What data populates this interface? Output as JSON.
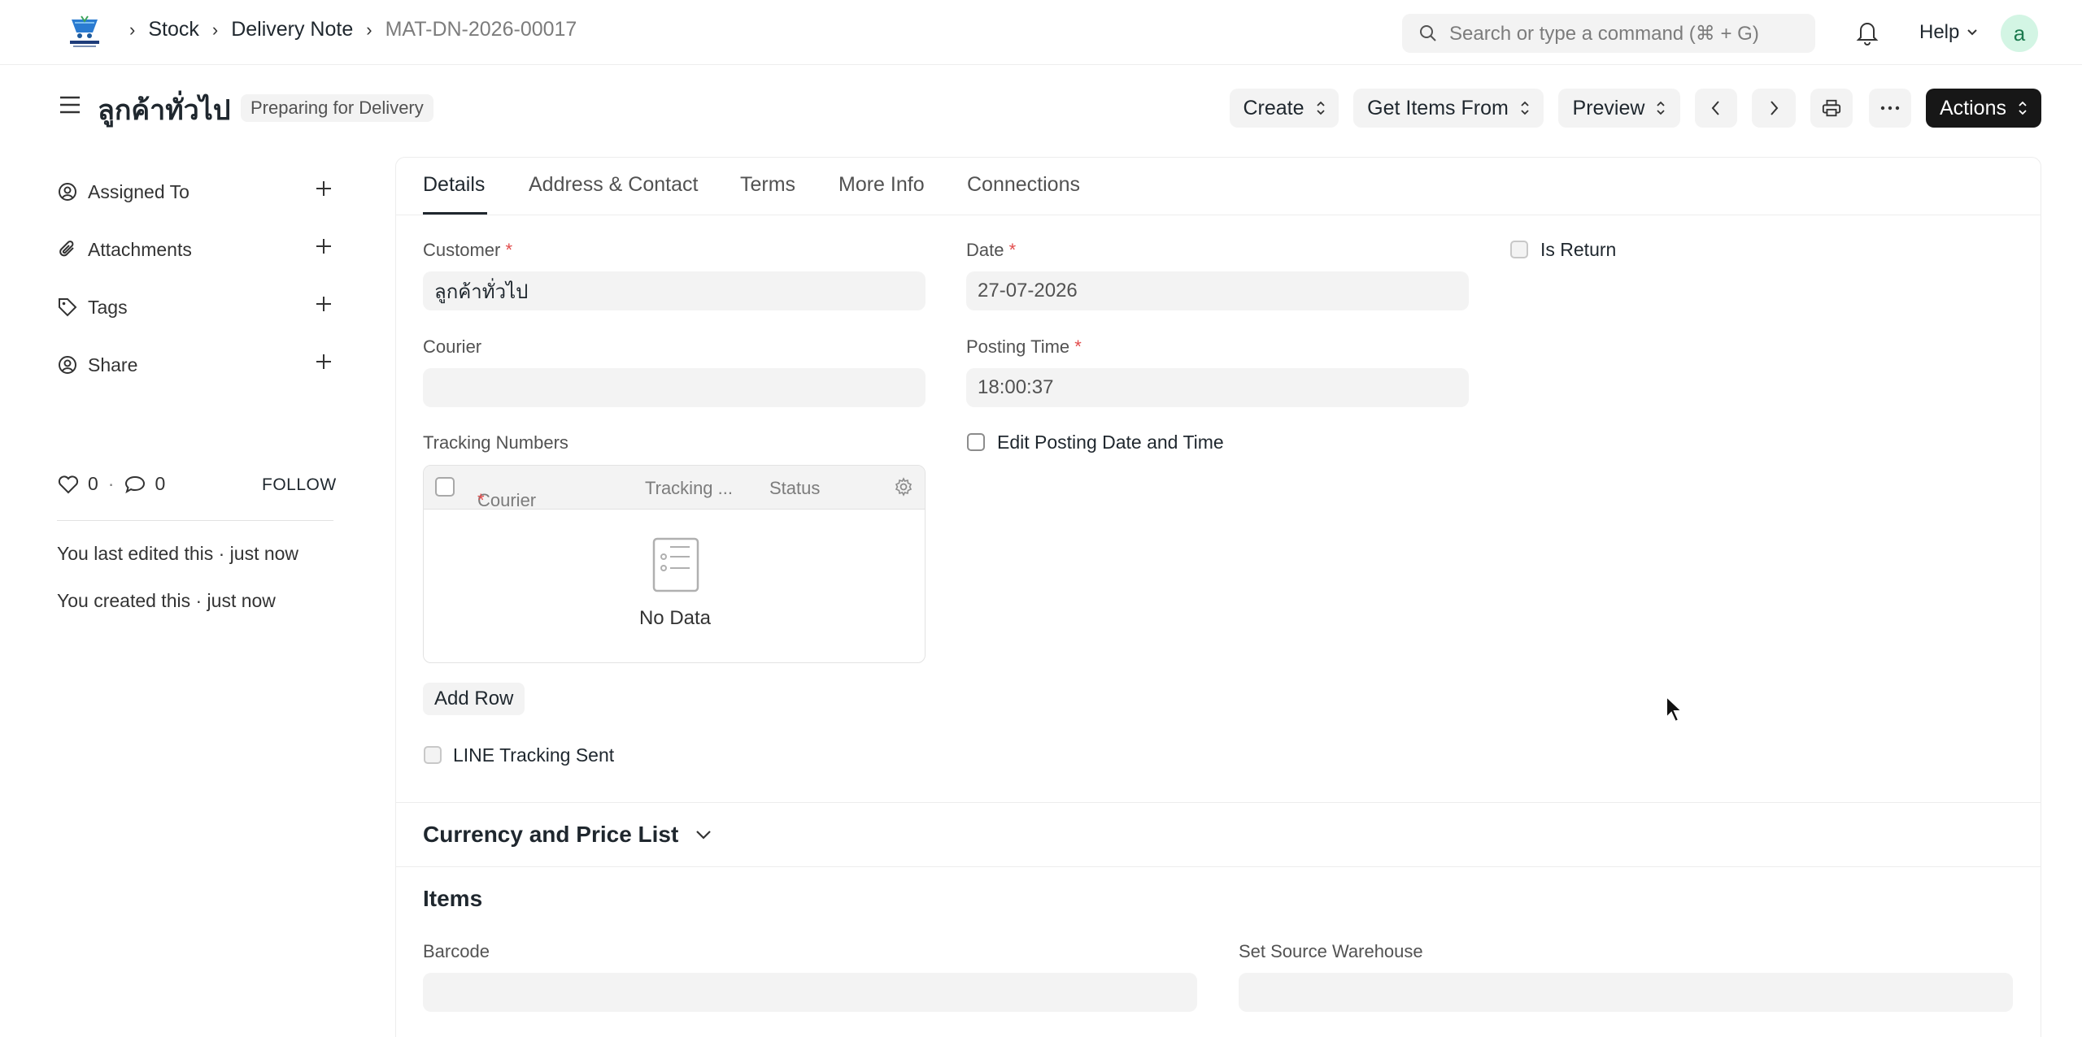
{
  "breadcrumb": {
    "items": [
      "Stock",
      "Delivery Note",
      "MAT-DN-2026-00017"
    ]
  },
  "search": {
    "placeholder": "Search or type a command (⌘ + G)"
  },
  "header": {
    "help_label": "Help",
    "avatar_letter": "a"
  },
  "doc": {
    "title": "ลูกค้าทั่วไป",
    "status": "Preparing for Delivery"
  },
  "toolbar": {
    "create_label": "Create",
    "get_items_label": "Get Items From",
    "preview_label": "Preview",
    "actions_label": "Actions"
  },
  "sidebar": {
    "items": [
      {
        "label": "Assigned To",
        "icon": "assign-icon"
      },
      {
        "label": "Attachments",
        "icon": "paperclip-icon"
      },
      {
        "label": "Tags",
        "icon": "tag-icon"
      },
      {
        "label": "Share",
        "icon": "share-icon"
      }
    ],
    "likes_count": "0",
    "comments_count": "0",
    "follow_label": "FOLLOW",
    "last_edited": "You last edited this · just now",
    "created": "You created this · just now"
  },
  "tabs": [
    "Details",
    "Address & Contact",
    "Terms",
    "More Info",
    "Connections"
  ],
  "form": {
    "customer_label": "Customer",
    "customer_value": "ลูกค้าทั่วไป",
    "date_label": "Date",
    "date_value": "27-07-2026",
    "is_return_label": "Is Return",
    "courier_label": "Courier",
    "courier_value": "",
    "posting_time_label": "Posting Time",
    "posting_time_value": "18:00:37",
    "edit_posting_label": "Edit Posting Date and Time",
    "tracking_numbers_label": "Tracking Numbers",
    "tracking_grid": {
      "columns": [
        "Courier",
        "Tracking ...",
        "Status"
      ],
      "empty_text": "No Data",
      "add_row_label": "Add Row"
    },
    "line_tracking_label": "LINE Tracking Sent"
  },
  "sections": {
    "currency_title": "Currency and Price List",
    "items_title": "Items",
    "barcode_label": "Barcode",
    "source_warehouse_label": "Set Source Warehouse"
  },
  "colors": {
    "required": "#e24c4c",
    "primary_dark": "#171717",
    "field_bg": "#f3f3f3"
  }
}
